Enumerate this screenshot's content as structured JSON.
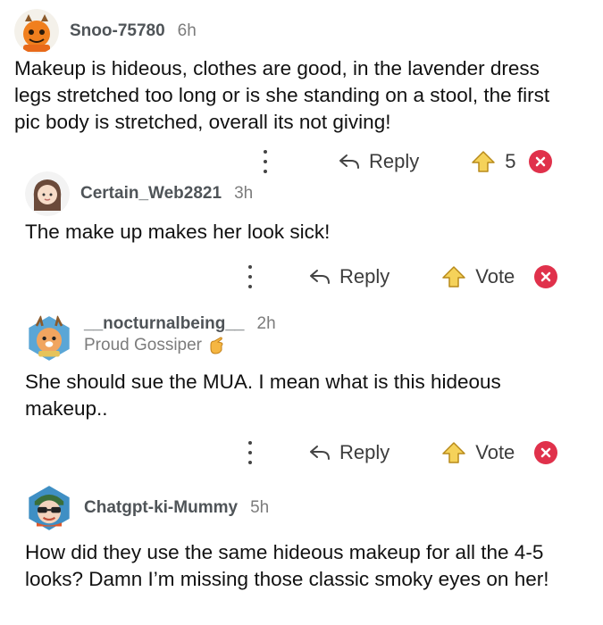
{
  "comments": [
    {
      "username": "Snoo-75780",
      "age": "6h",
      "flair": "",
      "body": "Makeup is hideous, clothes are good, in the lavender dress legs stretched too long or is she standing on a stool, the first pic body is stretched, overall its not giving!",
      "actions": {
        "reply": "Reply",
        "vote": "5"
      },
      "avatar_icon": "avatar-orange-character-icon"
    },
    {
      "username": "Certain_Web2821",
      "age": "3h",
      "flair": "",
      "body": "The make up makes her look sick!",
      "actions": {
        "reply": "Reply",
        "vote": "Vote"
      },
      "avatar_icon": "avatar-girl-icon"
    },
    {
      "username": "__nocturnalbeing__",
      "age": "2h",
      "flair": "Proud Gossiper",
      "body": "She should sue the MUA. I mean what is this hideous makeup..",
      "actions": {
        "reply": "Reply",
        "vote": "Vote"
      },
      "avatar_icon": "avatar-deer-icon"
    },
    {
      "username": "Chatgpt-ki-Mummy",
      "age": "5h",
      "flair": "",
      "body": "How did they use the same hideous makeup for all the 4-5 looks? Damn I’m missing those classic smoky eyes on her!",
      "actions": {
        "reply": "Reply",
        "vote": "Vote"
      },
      "avatar_icon": "avatar-sunglasses-icon"
    }
  ],
  "colors": {
    "downvote": "#e0314b",
    "upvote_fill": "#f5d25a",
    "username": "#4f5458"
  }
}
